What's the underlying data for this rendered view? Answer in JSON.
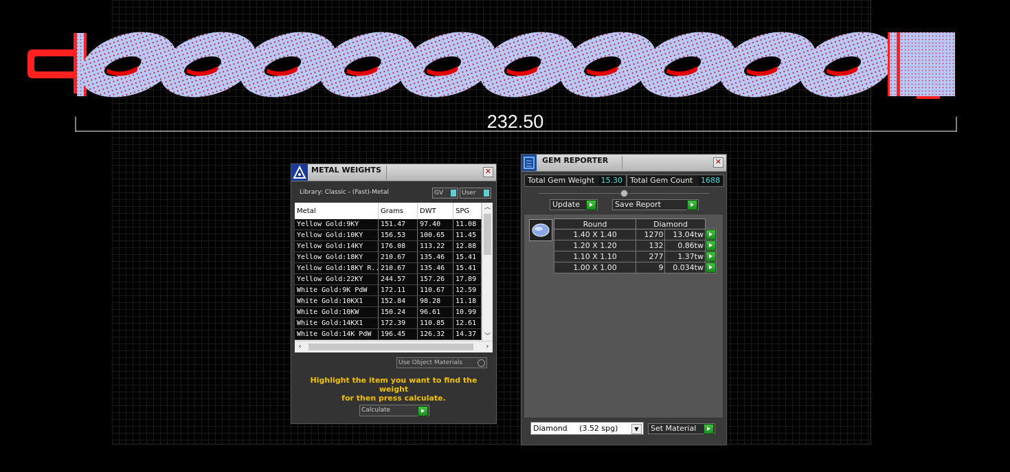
{
  "dimension": {
    "label": "232.50"
  },
  "metal_weights": {
    "title": "METAL WEIGHTS",
    "library_label": "Library: Classic - (Fast)-Metal",
    "toggle_gv": "GV",
    "toggle_user": "User",
    "columns": [
      "Metal",
      "Grams",
      "DWT",
      "SPG"
    ],
    "rows": [
      [
        "Yellow Gold:9KY",
        "151.47",
        "97.40",
        "11.08"
      ],
      [
        "Yellow Gold:10KY",
        "156.53",
        "100.65",
        "11.45"
      ],
      [
        "Yellow Gold:14KY",
        "176.08",
        "113.22",
        "12.88"
      ],
      [
        "Yellow Gold:18KY",
        "210.67",
        "135.46",
        "15.41"
      ],
      [
        "Yellow Gold:18KY R...",
        "210.67",
        "135.46",
        "15.41"
      ],
      [
        "Yellow Gold:22KY",
        "244.57",
        "157.26",
        "17.89"
      ],
      [
        "White Gold:9K PdW",
        "172.11",
        "110.67",
        "12.59"
      ],
      [
        "White Gold:10KX1",
        "152.84",
        "98.28",
        "11.18"
      ],
      [
        "White Gold:10KW",
        "150.24",
        "96.61",
        "10.99"
      ],
      [
        "White Gold:14KX1",
        "172.39",
        "110.85",
        "12.61"
      ],
      [
        "White Gold:14K PdW",
        "196.45",
        "126.32",
        "14.37"
      ]
    ],
    "use_object_materials": "Use Object Materials",
    "hint_line1": "Highlight the item you want to find the weight",
    "hint_line2": "for then press calculate.",
    "calculate_label": "Calculate"
  },
  "gem_reporter": {
    "title": "GEM REPORTER",
    "total_weight_label": "Total Gem Weight",
    "total_weight_value": "15.30",
    "total_count_label": "Total Gem Count",
    "total_count_value": "1688",
    "update_label": "Update",
    "save_report_label": "Save Report",
    "gem_header_shape": "Round",
    "gem_header_type": "Diamond",
    "gems": [
      [
        "1.40 X 1.40",
        "1270",
        "13.04tw"
      ],
      [
        "1.20 X 1.20",
        "132",
        "0.86tw"
      ],
      [
        "1.10 X 1.10",
        "277",
        "1.37tw"
      ],
      [
        "1.00 X 1.00",
        "9",
        "0.034tw"
      ]
    ],
    "material_select": "Diamond     (3.52 spg)",
    "set_material_label": "Set Material"
  },
  "colors": {
    "gem": "#b8c8f8",
    "metal": "#e00000",
    "accent_value": "#46e0e0",
    "hint": "#f2c200"
  }
}
